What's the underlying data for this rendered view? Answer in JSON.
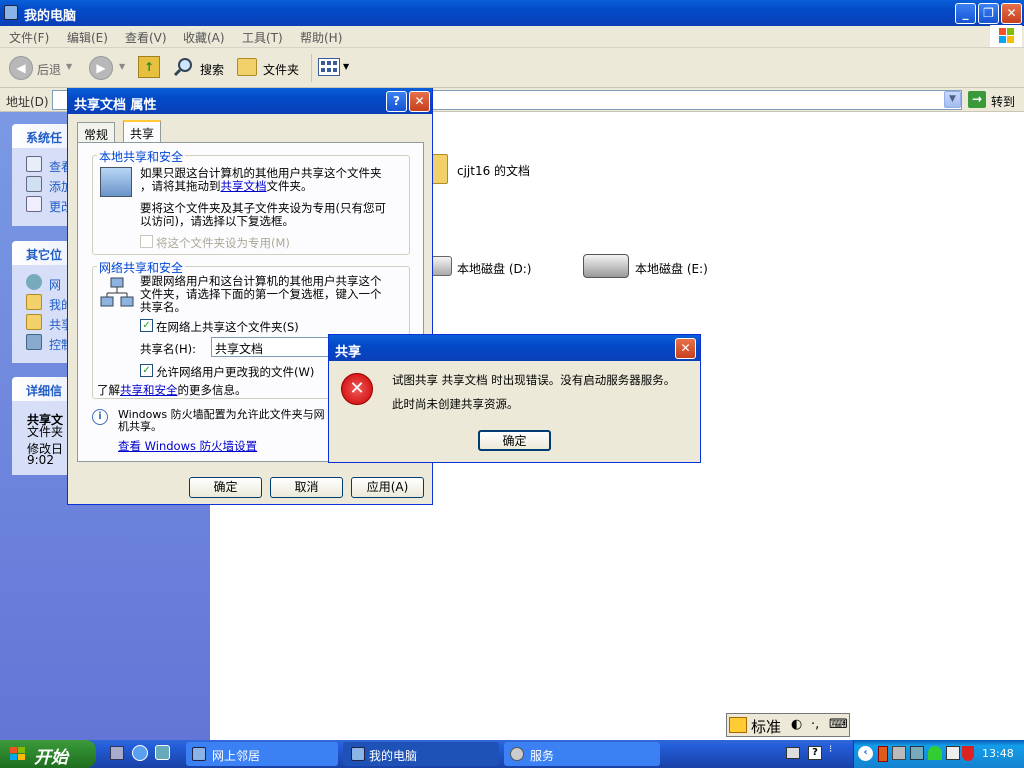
{
  "window": {
    "title": "我的电脑"
  },
  "menu": [
    "文件(F)",
    "编辑(E)",
    "查看(V)",
    "收藏(A)",
    "工具(T)",
    "帮助(H)"
  ],
  "toolbar": {
    "back": "后退",
    "search": "搜索",
    "folders": "文件夹"
  },
  "address": {
    "label": "地址(D)",
    "go": "转到"
  },
  "left_pane": {
    "system_tasks": {
      "title": "系统任",
      "links": [
        "查看",
        "添加",
        "更改"
      ]
    },
    "other_places": {
      "title": "其它位",
      "links": [
        "网",
        "我的",
        "共享",
        "控制"
      ]
    },
    "details": {
      "title": "详细信",
      "name": "共享文",
      "type": "文件夹",
      "modified_label": "修改日",
      "time": "9:02"
    }
  },
  "content": {
    "folder_label": "cjjt16 的文档",
    "drive_d": "本地磁盘 (D:)",
    "drive_e": "本地磁盘 (E:)"
  },
  "props_dialog": {
    "title": "共享文档 属性",
    "tabs": [
      "常规",
      "共享"
    ],
    "local": {
      "title": "本地共享和安全",
      "text1a": "如果只跟这台计算机的其他用户共享这个文件夹",
      "text1b": "，请将其拖动到",
      "text1_link": "共享文档",
      "text1c": "文件夹。",
      "text2a": "要将这个文件夹及其子文件夹设为专用(只有您可",
      "text2b": "以访问)，请选择以下复选框。",
      "private_checkbox": "将这个文件夹设为专用(M)"
    },
    "network": {
      "title": "网络共享和安全",
      "text_a": "要跟网络用户和这台计算机的其他用户共享这个",
      "text_b": "文件夹，请选择下面的第一个复选框，键入一个",
      "text_c": "共享名。",
      "share_checkbox": "在网络上共享这个文件夹(S)",
      "share_name_label": "共享名(H):",
      "share_name_value": "共享文档",
      "allow_change_checkbox": "允许网络用户更改我的文件(W)",
      "learn_prefix": "了解",
      "learn_link": "共享和安全",
      "learn_suffix": "的更多信息。"
    },
    "firewall": {
      "text_a": "Windows 防火墙配置为允许此文件夹与网",
      "text_b": "机共享。",
      "link": "查看 Windows 防火墙设置"
    },
    "buttons": {
      "ok": "确定",
      "cancel": "取消",
      "apply": "应用(A)"
    }
  },
  "error_dialog": {
    "title": "共享",
    "line1": "试图共享 共享文档 时出现错误。没有启动服务器服务。",
    "line2": "此时尚未创建共享资源。",
    "ok": "确定"
  },
  "ime": {
    "label": "标准"
  },
  "taskbar": {
    "start": "开始",
    "items": [
      "网上邻居",
      "我的电脑",
      "服务"
    ],
    "clock": "13:48"
  }
}
